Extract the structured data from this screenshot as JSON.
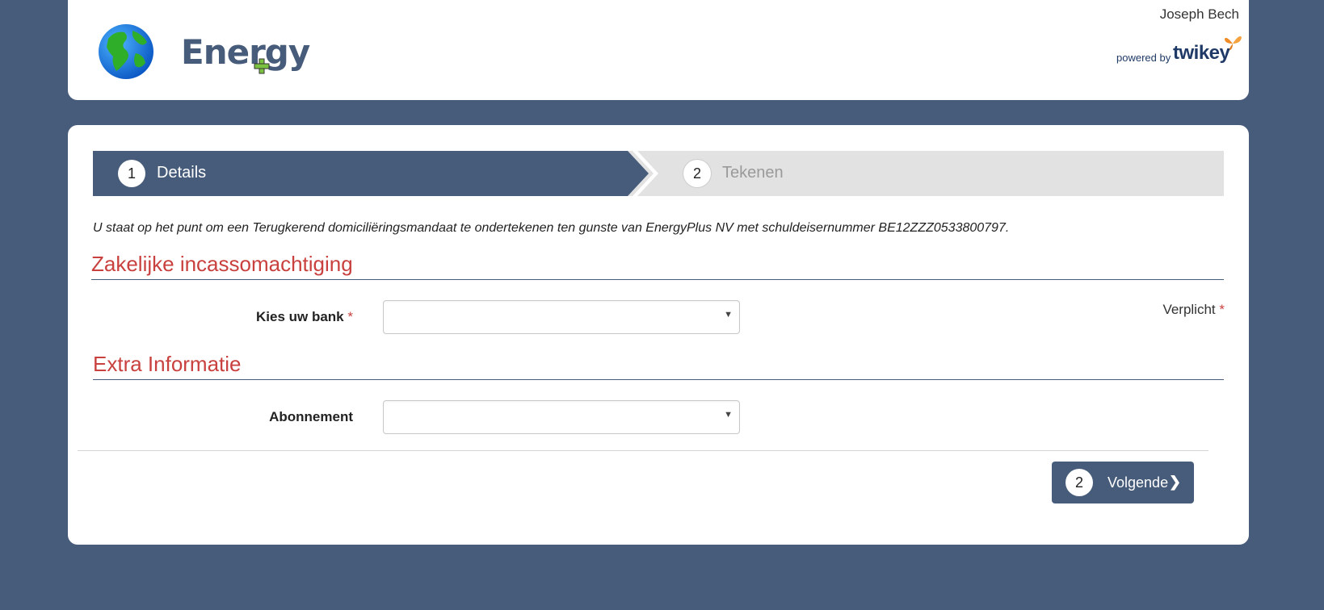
{
  "header": {
    "logo_text": "Energy",
    "user_name": "Joseph Bech",
    "powered_by": "powered by",
    "brand": "twikey"
  },
  "steps": [
    {
      "number": "1",
      "label": "Details",
      "active": true
    },
    {
      "number": "2",
      "label": "Tekenen",
      "active": false
    }
  ],
  "intro_text": "U staat op het punt om een Terugkerend domiciliëringsmandaat te ondertekenen ten gunste van EnergyPlus NV met schuldeisernummer BE12ZZZ0533800797.",
  "sections": {
    "mandate": {
      "title": "Zakelijke incassomachtiging",
      "bank_label": "Kies uw bank",
      "bank_required": "*",
      "bank_value": ""
    },
    "extra": {
      "title": "Extra Informatie",
      "subscription_label": "Abonnement",
      "subscription_value": ""
    }
  },
  "required_note": {
    "text": "Verplicht",
    "star": "*"
  },
  "next_button": {
    "step": "2",
    "label": "Volgende"
  },
  "colors": {
    "background": "#475c7a",
    "primary": "#475c7a",
    "section_title": "#c9413f",
    "inactive_step": "#e2e2e2"
  }
}
